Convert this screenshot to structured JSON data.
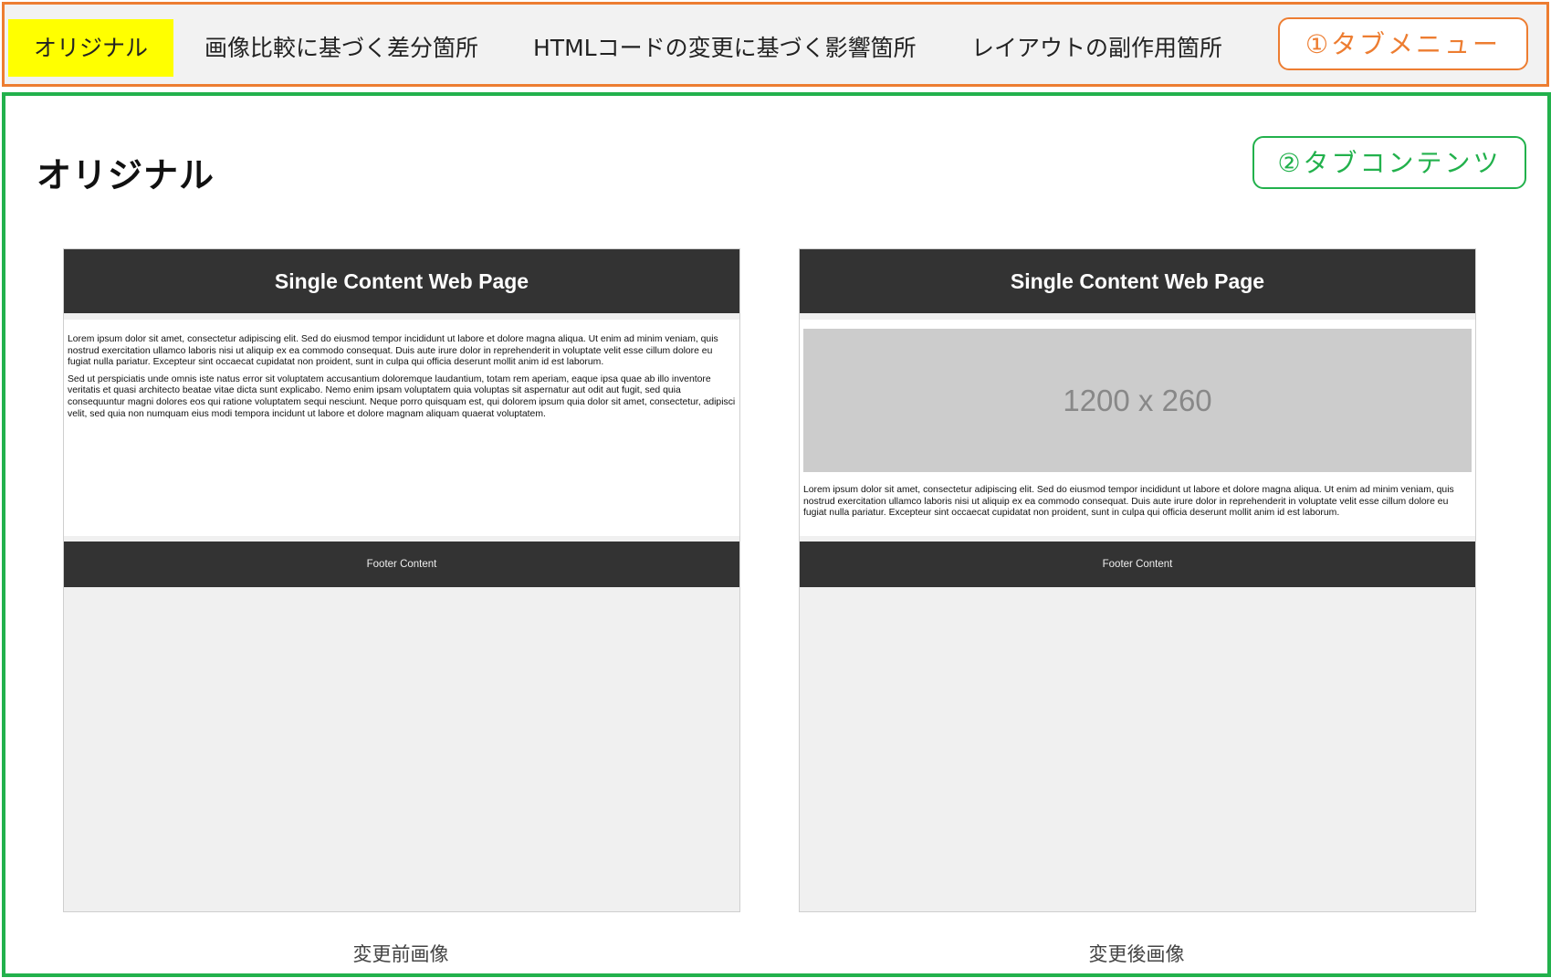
{
  "tab_menu": {
    "tabs": [
      {
        "label": "オリジナル",
        "active": true
      },
      {
        "label": "画像比較に基づく差分箇所",
        "active": false
      },
      {
        "label": "HTMLコードの変更に基づく影響箇所",
        "active": false
      },
      {
        "label": "レイアウトの副作用箇所",
        "active": false
      }
    ],
    "callout": "①タブメニュー"
  },
  "tab_content": {
    "title": "オリジナル",
    "callout": "②タブコンテンツ",
    "before": {
      "header": "Single Content Web Page",
      "paragraph1": "Lorem ipsum dolor sit amet, consectetur adipiscing elit. Sed do eiusmod tempor incididunt ut labore et dolore magna aliqua. Ut enim ad minim veniam, quis nostrud exercitation ullamco laboris nisi ut aliquip ex ea commodo consequat. Duis aute irure dolor in reprehenderit in voluptate velit esse cillum dolore eu fugiat nulla pariatur. Excepteur sint occaecat cupidatat non proident, sunt in culpa qui officia deserunt mollit anim id est laborum.",
      "paragraph2": "Sed ut perspiciatis unde omnis iste natus error sit voluptatem accusantium doloremque laudantium, totam rem aperiam, eaque ipsa quae ab illo inventore veritatis et quasi architecto beatae vitae dicta sunt explicabo. Nemo enim ipsam voluptatem quia voluptas sit aspernatur aut odit aut fugit, sed quia consequuntur magni dolores eos qui ratione voluptatem sequi nesciunt. Neque porro quisquam est, qui dolorem ipsum quia dolor sit amet, consectetur, adipisci velit, sed quia non numquam eius modi tempora incidunt ut labore et dolore magnam aliquam quaerat voluptatem.",
      "footer": "Footer Content",
      "caption": "変更前画像"
    },
    "after": {
      "header": "Single Content Web Page",
      "placeholder": "1200 x 260",
      "paragraph1": "Lorem ipsum dolor sit amet, consectetur adipiscing elit. Sed do eiusmod tempor incididunt ut labore et dolore magna aliqua. Ut enim ad minim veniam, quis nostrud exercitation ullamco laboris nisi ut aliquip ex ea commodo consequat. Duis aute irure dolor in reprehenderit in voluptate velit esse cillum dolore eu fugiat nulla pariatur. Excepteur sint occaecat cupidatat non proident, sunt in culpa qui officia deserunt mollit anim id est laborum.",
      "footer": "Footer Content",
      "caption": "変更後画像"
    }
  },
  "colors": {
    "menu_frame": "#ed7d31",
    "content_frame": "#22b14c",
    "active_tab": "#ffff00",
    "page_header": "#333333",
    "placeholder": "#cccccc"
  }
}
